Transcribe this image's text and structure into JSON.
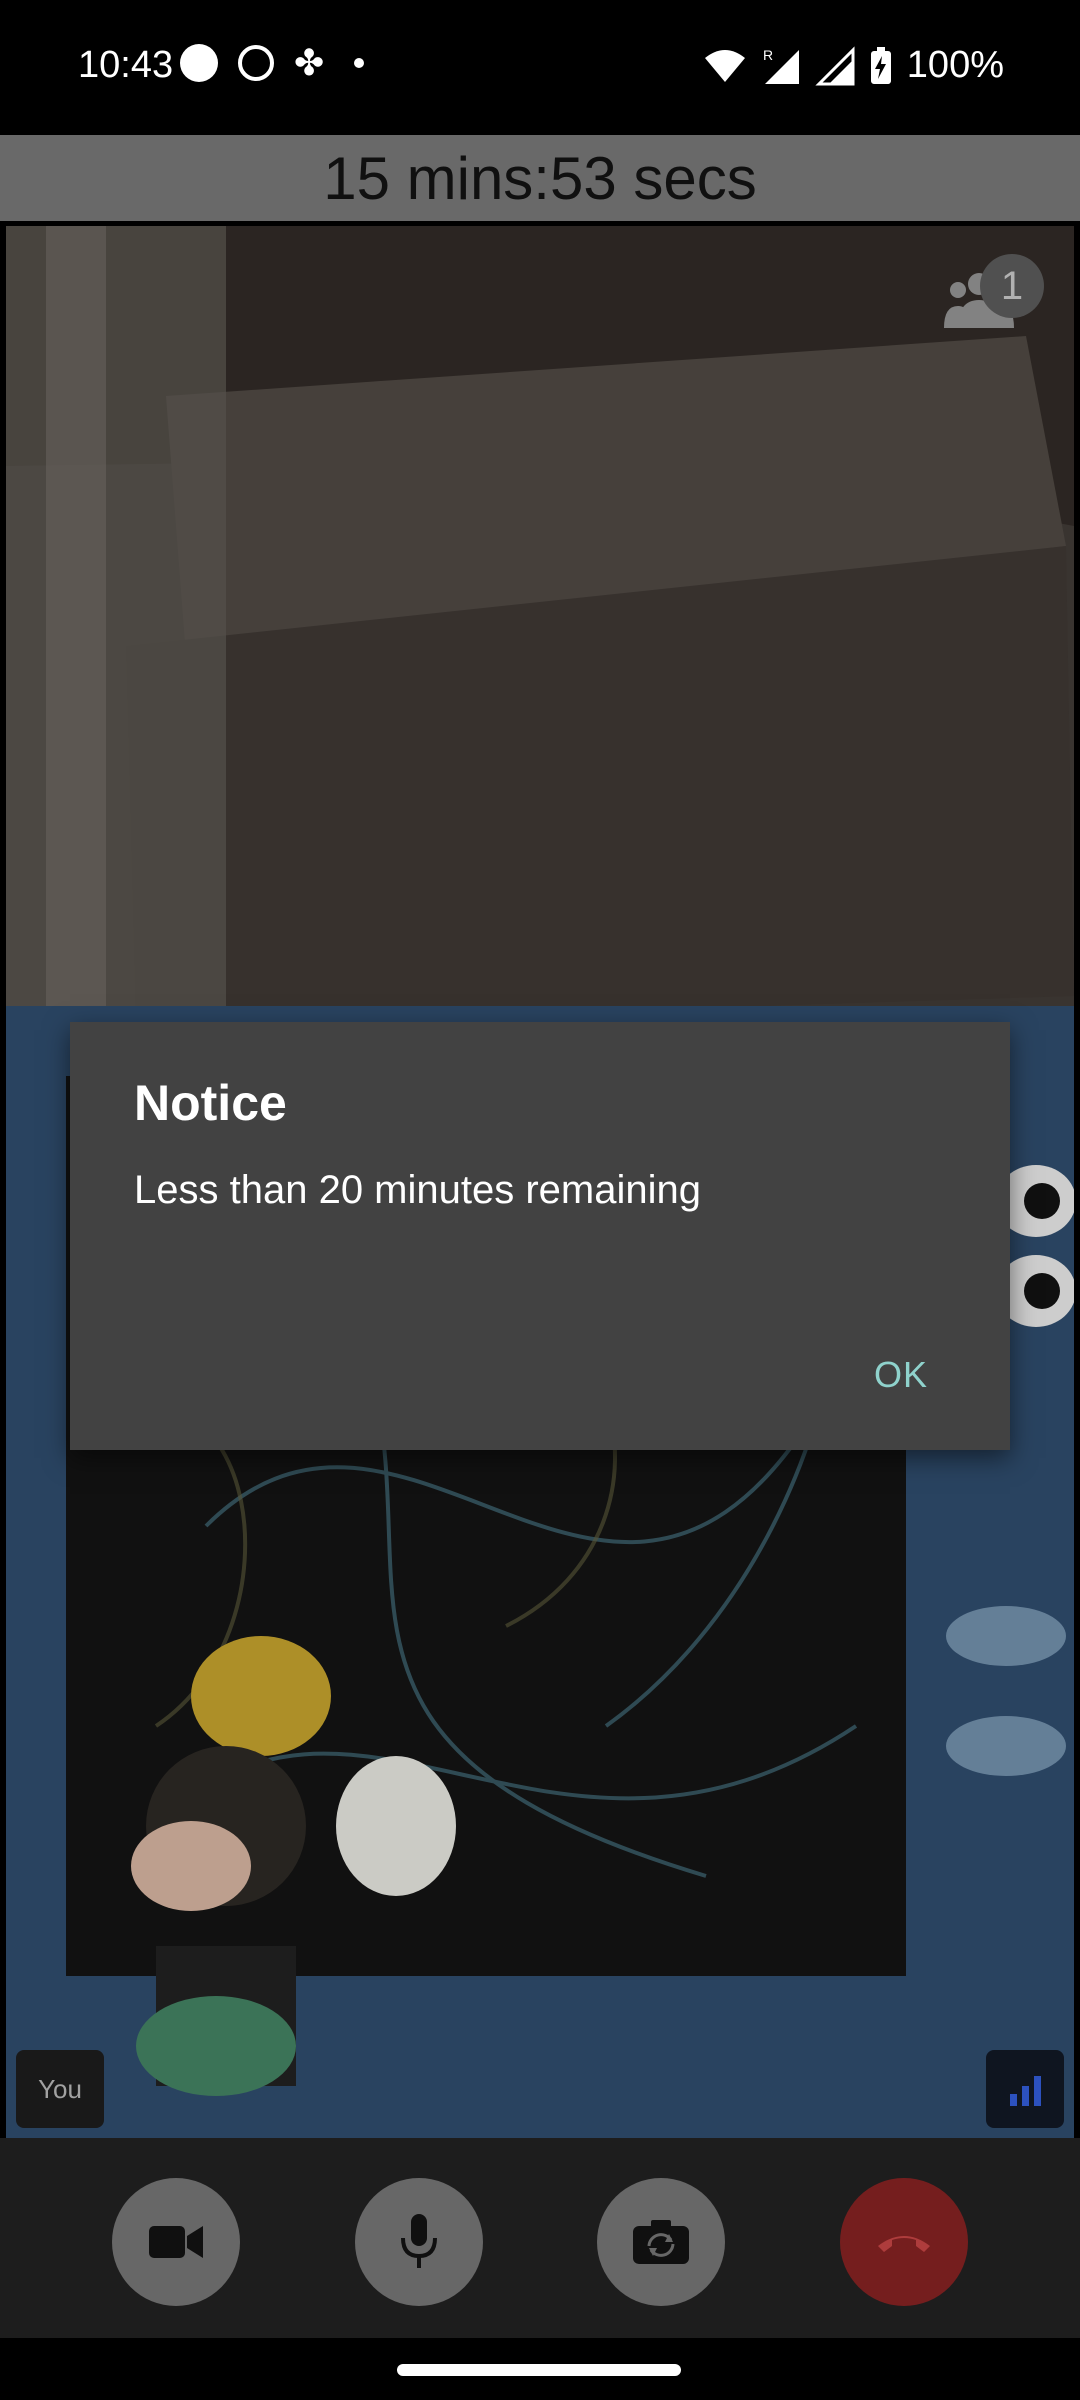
{
  "status_bar": {
    "time": "10:43",
    "battery": "100%",
    "notification_icons": [
      "circle-icon",
      "whatsapp-icon",
      "slack-icon",
      "dot-icon"
    ],
    "system_icons": [
      "wifi-icon",
      "signal-roaming-icon",
      "signal-icon",
      "battery-charging-icon"
    ]
  },
  "timer": {
    "text": "15 mins:53 secs"
  },
  "video": {
    "participants_count": "1",
    "self_label": "You"
  },
  "dialog": {
    "title": "Notice",
    "message": "Less than 20 minutes remaining",
    "ok_label": "OK"
  },
  "controls": {
    "buttons": [
      "video-camera-icon",
      "microphone-icon",
      "switch-camera-icon",
      "end-call-icon"
    ]
  },
  "colors": {
    "accent": "#8fd2cc",
    "end_call": "#7c2020",
    "dialog_bg": "#424242"
  }
}
